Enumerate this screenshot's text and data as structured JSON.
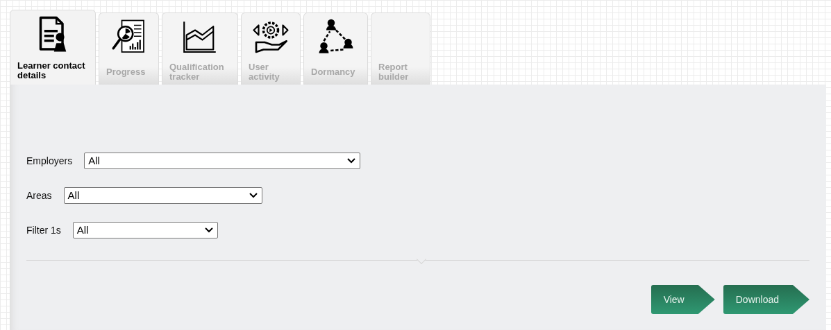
{
  "tabs": [
    {
      "label": "Learner contact details",
      "selected": true
    },
    {
      "label": "Progress",
      "selected": false
    },
    {
      "label": "Qualification tracker",
      "selected": false
    },
    {
      "label": "User activity",
      "selected": false
    },
    {
      "label": "Dormancy",
      "selected": false
    },
    {
      "label": "Report builder",
      "selected": false
    }
  ],
  "filters": [
    {
      "label": "Employers",
      "value": "All"
    },
    {
      "label": "Areas",
      "value": "All"
    },
    {
      "label": "Filter 1s",
      "value": "All"
    }
  ],
  "buttons": [
    "View",
    "Download"
  ]
}
